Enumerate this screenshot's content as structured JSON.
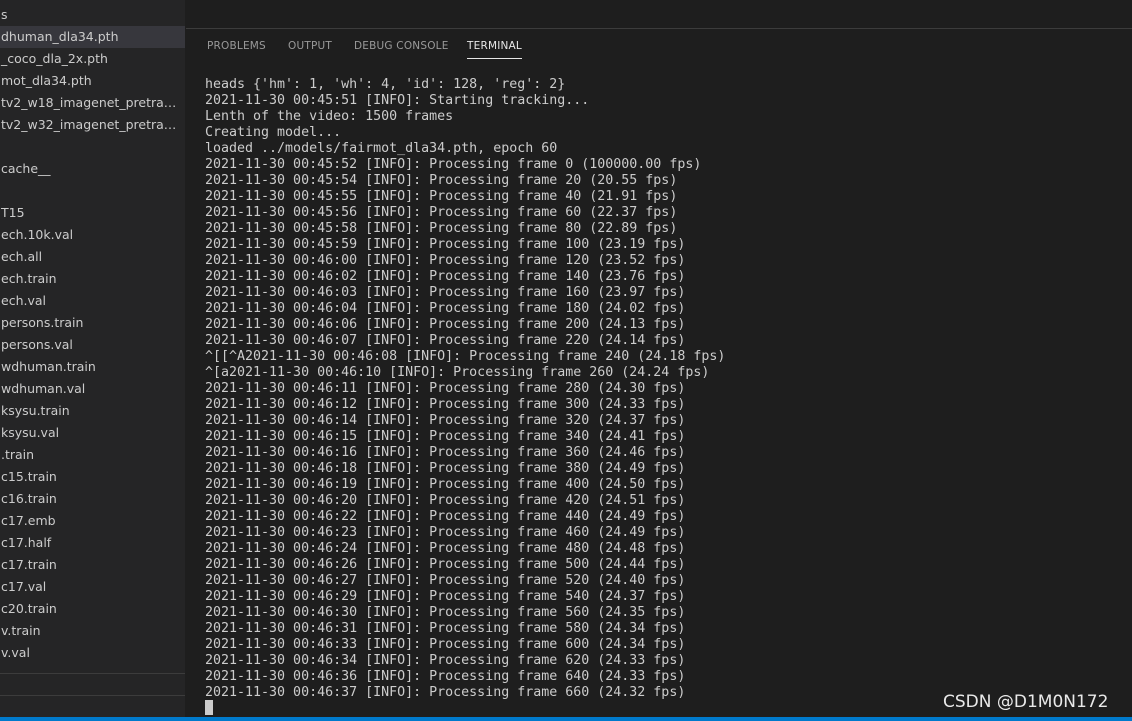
{
  "sidebar": {
    "items": [
      {
        "label": "s",
        "selected": false
      },
      {
        "label": "dhuman_dla34.pth",
        "selected": true
      },
      {
        "label": "_coco_dla_2x.pth",
        "selected": false
      },
      {
        "label": "mot_dla34.pth",
        "selected": false
      },
      {
        "label": "tv2_w18_imagenet_pretrain...",
        "selected": false
      },
      {
        "label": "tv2_w32_imagenet_pretrain...",
        "selected": false
      },
      {
        "label": "",
        "selected": false
      },
      {
        "label": "cache__",
        "selected": false
      },
      {
        "label": "",
        "selected": false
      },
      {
        "label": "T15",
        "selected": false
      },
      {
        "label": "ech.10k.val",
        "selected": false
      },
      {
        "label": "ech.all",
        "selected": false
      },
      {
        "label": "ech.train",
        "selected": false
      },
      {
        "label": "ech.val",
        "selected": false
      },
      {
        "label": "persons.train",
        "selected": false
      },
      {
        "label": "persons.val",
        "selected": false
      },
      {
        "label": "wdhuman.train",
        "selected": false
      },
      {
        "label": "wdhuman.val",
        "selected": false
      },
      {
        "label": "ksysu.train",
        "selected": false
      },
      {
        "label": "ksysu.val",
        "selected": false
      },
      {
        "label": ".train",
        "selected": false
      },
      {
        "label": "c15.train",
        "selected": false
      },
      {
        "label": "c16.train",
        "selected": false
      },
      {
        "label": "c17.emb",
        "selected": false
      },
      {
        "label": "c17.half",
        "selected": false
      },
      {
        "label": "c17.train",
        "selected": false
      },
      {
        "label": "c17.val",
        "selected": false
      },
      {
        "label": "c20.train",
        "selected": false
      },
      {
        "label": "v.train",
        "selected": false
      },
      {
        "label": "v.val",
        "selected": false
      }
    ]
  },
  "panel": {
    "tabs": [
      "PROBLEMS",
      "OUTPUT",
      "DEBUG CONSOLE",
      "TERMINAL"
    ],
    "active_tab": "TERMINAL"
  },
  "terminal": {
    "lines": [
      "heads {'hm': 1, 'wh': 4, 'id': 128, 'reg': 2}",
      "2021-11-30 00:45:51 [INFO]: Starting tracking...",
      "Lenth of the video: 1500 frames",
      "Creating model...",
      "loaded ../models/fairmot_dla34.pth, epoch 60",
      "2021-11-30 00:45:52 [INFO]: Processing frame 0 (100000.00 fps)",
      "2021-11-30 00:45:54 [INFO]: Processing frame 20 (20.55 fps)",
      "2021-11-30 00:45:55 [INFO]: Processing frame 40 (21.91 fps)",
      "2021-11-30 00:45:56 [INFO]: Processing frame 60 (22.37 fps)",
      "2021-11-30 00:45:58 [INFO]: Processing frame 80 (22.89 fps)",
      "2021-11-30 00:45:59 [INFO]: Processing frame 100 (23.19 fps)",
      "2021-11-30 00:46:00 [INFO]: Processing frame 120 (23.52 fps)",
      "2021-11-30 00:46:02 [INFO]: Processing frame 140 (23.76 fps)",
      "2021-11-30 00:46:03 [INFO]: Processing frame 160 (23.97 fps)",
      "2021-11-30 00:46:04 [INFO]: Processing frame 180 (24.02 fps)",
      "2021-11-30 00:46:06 [INFO]: Processing frame 200 (24.13 fps)",
      "2021-11-30 00:46:07 [INFO]: Processing frame 220 (24.14 fps)",
      "^[[^A2021-11-30 00:46:08 [INFO]: Processing frame 240 (24.18 fps)",
      "^[a2021-11-30 00:46:10 [INFO]: Processing frame 260 (24.24 fps)",
      "2021-11-30 00:46:11 [INFO]: Processing frame 280 (24.30 fps)",
      "2021-11-30 00:46:12 [INFO]: Processing frame 300 (24.33 fps)",
      "2021-11-30 00:46:14 [INFO]: Processing frame 320 (24.37 fps)",
      "2021-11-30 00:46:15 [INFO]: Processing frame 340 (24.41 fps)",
      "2021-11-30 00:46:16 [INFO]: Processing frame 360 (24.46 fps)",
      "2021-11-30 00:46:18 [INFO]: Processing frame 380 (24.49 fps)",
      "2021-11-30 00:46:19 [INFO]: Processing frame 400 (24.50 fps)",
      "2021-11-30 00:46:20 [INFO]: Processing frame 420 (24.51 fps)",
      "2021-11-30 00:46:22 [INFO]: Processing frame 440 (24.49 fps)",
      "2021-11-30 00:46:23 [INFO]: Processing frame 460 (24.49 fps)",
      "2021-11-30 00:46:24 [INFO]: Processing frame 480 (24.48 fps)",
      "2021-11-30 00:46:26 [INFO]: Processing frame 500 (24.44 fps)",
      "2021-11-30 00:46:27 [INFO]: Processing frame 520 (24.40 fps)",
      "2021-11-30 00:46:29 [INFO]: Processing frame 540 (24.37 fps)",
      "2021-11-30 00:46:30 [INFO]: Processing frame 560 (24.35 fps)",
      "2021-11-30 00:46:31 [INFO]: Processing frame 580 (24.34 fps)",
      "2021-11-30 00:46:33 [INFO]: Processing frame 600 (24.34 fps)",
      "2021-11-30 00:46:34 [INFO]: Processing frame 620 (24.33 fps)",
      "2021-11-30 00:46:36 [INFO]: Processing frame 640 (24.33 fps)",
      "2021-11-30 00:46:37 [INFO]: Processing frame 660 (24.32 fps)"
    ]
  },
  "watermark": {
    "text": "CSDN @D1M0N172"
  },
  "colors": {
    "background": "#1e1e1e",
    "sidebar": "#252526",
    "selection": "#37373d",
    "text": "#cccccc",
    "status_bar": "#007acc"
  }
}
